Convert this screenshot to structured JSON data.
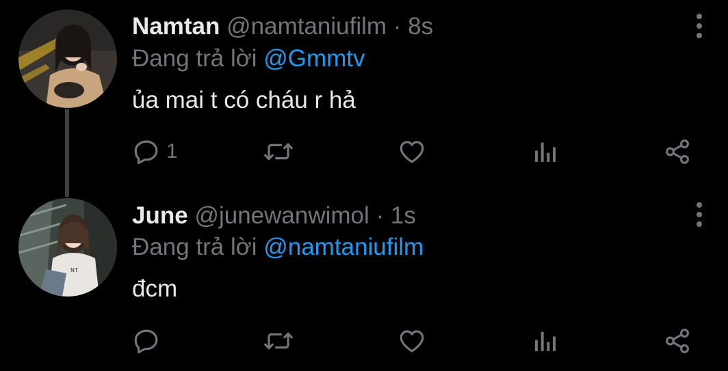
{
  "tweets": [
    {
      "display_name": "Namtan",
      "handle": "@namtaniufilm",
      "separator": " · ",
      "time": "8s",
      "reply_prefix": "Đang trả lời ",
      "reply_to": "@Gmmtv",
      "text": "ủa mai t có cháu r hả",
      "reply_count": "1"
    },
    {
      "display_name": "June",
      "handle": "@junewanwimol",
      "separator": " · ",
      "time": "1s",
      "reply_prefix": "Đang trả lời ",
      "reply_to": "@namtaniufilm",
      "text": "đcm",
      "reply_count": ""
    }
  ],
  "colors": {
    "background": "#000000",
    "primary_text": "#e7e9ea",
    "secondary_text": "#71767b",
    "accent": "#1d9bf0",
    "thread_line": "#3e4144"
  },
  "icons": [
    "reply-icon",
    "retweet-icon",
    "like-icon",
    "views-icon",
    "share-icon",
    "more-options-icon"
  ]
}
